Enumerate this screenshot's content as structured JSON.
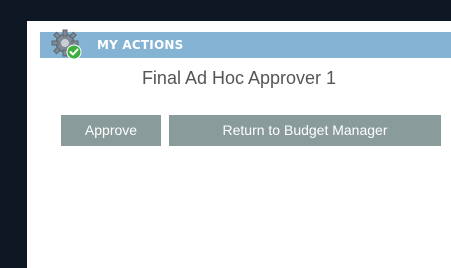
{
  "header": {
    "title": "MY ACTIONS",
    "icon": "gear-check-icon"
  },
  "role_label": "Final Ad Hoc Approver 1",
  "actions": {
    "approve_label": "Approve",
    "return_label": "Return to Budget Manager"
  },
  "colors": {
    "page_background": "#0f1724",
    "panel_background": "#ffffff",
    "header_background": "#84b3d4",
    "button_background": "#8a9b9b",
    "role_text": "#555555",
    "check_green": "#3fae3f"
  }
}
